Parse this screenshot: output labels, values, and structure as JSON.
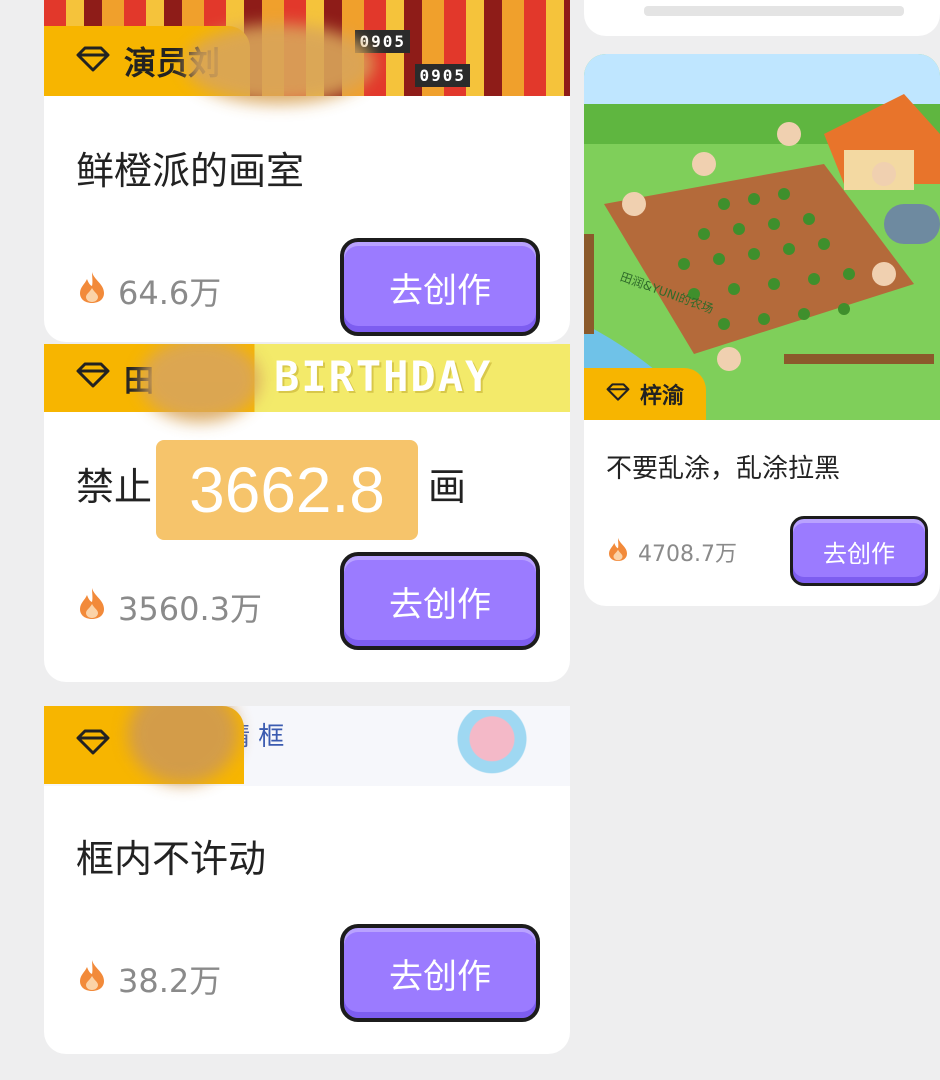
{
  "colors": {
    "badge": "#f7b500",
    "button": "#9b7bff",
    "button_border": "#1c1c1c",
    "card": "#ffffff",
    "background": "#eeeeef",
    "stat_text": "#8a8a8a",
    "flame": "#f28a3a"
  },
  "left_cards": [
    {
      "badge_icon": "diamond-icon",
      "badge_text": "演员刘",
      "title": "鲜橙派的画室",
      "heat": "64.6万",
      "button": "去创作",
      "banner_text": "0905"
    },
    {
      "badge_icon": "diamond-icon",
      "badge_text": "田",
      "title_prefix": "禁止",
      "title_suffix": "画",
      "heat": "3560.3万",
      "button": "去创作",
      "banner_text": "BIRTHDAY"
    },
    {
      "badge_icon": "diamond-icon",
      "badge_text": "",
      "title": "框内不许动",
      "heat": "38.2万",
      "button": "去创作",
      "banner_text": "晴 框"
    }
  ],
  "right_card": {
    "badge_icon": "diamond-icon",
    "badge_text": "梓渝",
    "title": "不要乱涂，乱涂拉黑",
    "heat": "4708.7万",
    "button": "去创作",
    "illustration_text": "田润&YUNI的农场"
  },
  "overlay_number": "3662.8"
}
